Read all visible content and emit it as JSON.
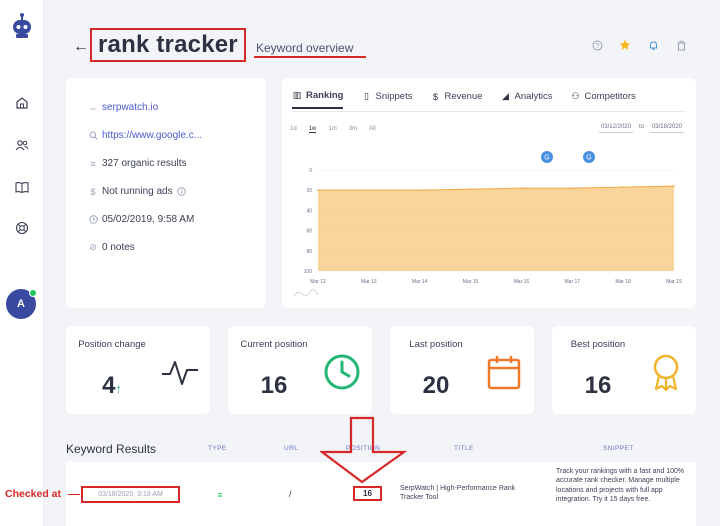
{
  "header": {
    "title": "rank tracker",
    "subtitle": "Keyword overview"
  },
  "info": {
    "domain": "serpwatch.io",
    "search_engine": "https://www.google.c...",
    "organic_results": "327 organic results",
    "ads": "Not running ads",
    "date": "05/02/2019, 9:58 AM",
    "notes": "0 notes"
  },
  "tabs": [
    "Ranking",
    "Snippets",
    "Revenue",
    "Analytics",
    "Competitors"
  ],
  "ranges": [
    "1d",
    "1w",
    "1m",
    "3m",
    "All"
  ],
  "date_range": {
    "from": "03/12/2020",
    "to": "to",
    "end": "03/18/2020"
  },
  "chart_data": {
    "type": "area",
    "x": [
      "Mar 12",
      "Mar 13",
      "Mar 14",
      "Mar 15",
      "Mar 16",
      "Mar 17",
      "Mar 18",
      "Mar 19"
    ],
    "values": [
      20,
      20,
      20,
      19,
      18,
      18,
      17,
      16
    ],
    "y_ticks": [
      "0",
      "20",
      "40",
      "60",
      "80",
      "100"
    ],
    "ylim": [
      0,
      100
    ],
    "y_inverted": true,
    "color": "#f8c77a",
    "grid": true
  },
  "stats": [
    {
      "label": "Position change",
      "value": "4",
      "suffix": "↑",
      "icon": "pulse-icon",
      "color": "#2d3142"
    },
    {
      "label": "Current position",
      "value": "16",
      "icon": "clock-icon",
      "color": "#22b573"
    },
    {
      "label": "Last position",
      "value": "20",
      "icon": "calendar-icon",
      "color": "#f07a2b"
    },
    {
      "label": "Best position",
      "value": "16",
      "icon": "award-icon",
      "color": "#f0b429"
    }
  ],
  "results": {
    "title": "Keyword Results",
    "columns": [
      "TYPE",
      "URL",
      "POSITION",
      "TITLE",
      "SNIPPET"
    ],
    "row": {
      "checked_at": "03/18/2020, 3:18 AM",
      "url": "/",
      "position": "16",
      "title": "SerpWatch | High-Performance Rank Tracker Tool",
      "snippet": "Track your rankings with a fast and 100% accurate rank checker. Manage multiple locations and projects with full app integration. Try it 15 days free."
    }
  },
  "annotation": {
    "checked_label": "Checked at"
  },
  "sidebar": {
    "avatar": "A"
  }
}
